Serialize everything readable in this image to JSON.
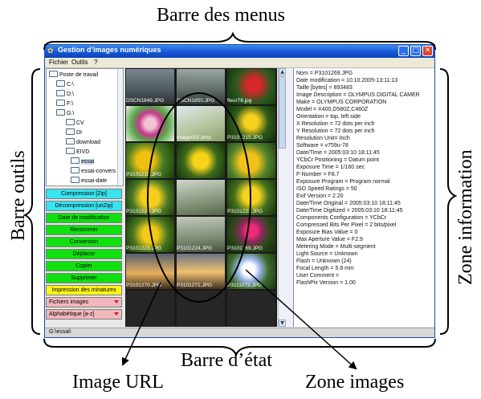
{
  "annotations": {
    "menus": "Barre des menus",
    "outils": "Barre outils",
    "info": "Zone information",
    "etat": "Barre d’état",
    "url": "Image URL",
    "images": "Zone images"
  },
  "window": {
    "title": "Gestion d’images numériques",
    "menu": [
      "Fichier",
      "Outils",
      "?"
    ],
    "tree": [
      "Poste de travail",
      "C:\\",
      "D:\\",
      "F:\\",
      "G:\\",
      "CV",
      "DI",
      "download",
      "EIVD",
      "essai",
      "essai-convers",
      "essai-date"
    ],
    "buttons": [
      "Compression [Zip]",
      "Décompression [unZip]",
      "Date de modification",
      "Renommer",
      "Conversion",
      "Déplacer",
      "Copier",
      "Supprimer",
      "Impression des minatures"
    ],
    "drops": [
      "Fichiers images",
      "Alphabétique [a-z]"
    ],
    "captions": [
      "DSCN1849.JPG",
      "DSCN1850.JPG",
      "fleur78.jpg",
      "",
      "image002.bmp",
      "P3101215.JPG",
      "P3101218.JPG",
      "",
      "",
      "P3101220.JPG",
      "",
      "P3101222.JPG",
      "P3101223.JPG",
      "P3101224.JPG",
      "P3101269.JPG",
      "P3101270.JPG",
      "P3101271.JPG",
      "P3111073.JPG"
    ],
    "info": [
      "Nom = P3101269.JPG",
      "Date modification = 10.10.2005-13:11:13",
      "Taille [bytes] = 893483",
      "Image Description = OLYMPUS DIGITAL CAMER",
      "Make = OLYMPUS CORPORATION",
      "Model = X400,D580Z,C460Z",
      "Orientation = top, left side",
      "X Resolution = 72 dots per inch",
      "Y Resolution = 72 dots per inch",
      "Resolution Unit= Inch",
      "Software = v759u-78",
      "Date/Time = 2005:03:10 18:11:45",
      "YCbCr Positioning = Datum point",
      "Exposure Time = 1/160 sec",
      "F-Number = F8.7",
      "Exposure Program = Program normal",
      "ISO Speed Ratings = 50",
      "Exif Version = 2.20",
      "Date/Time Original = 2005:03:10 18:11:45",
      "Date/Time Digitized = 2005:03:10 18:11:45",
      "Components Configuration = YCbCr",
      "Compressed Bits Per Pixel = 2 bits/pixel",
      "Exposure Bias Value = 0",
      "Max Aperture Value = F2.9",
      "Metering Mode = Multi-segment",
      "Light Source = Unknown",
      "Flash = Unknown (24)",
      "Focal Length = 5.8 mm",
      "User Comment =",
      "FlashPix Version = 1.00"
    ],
    "status": "G:\\essai\\"
  },
  "colors": {
    "btn_cyan": "#38e4f0",
    "btn_green": "#10e010",
    "btn_yellow": "#fbf31a",
    "drop_pink": "#f2b6bd"
  }
}
